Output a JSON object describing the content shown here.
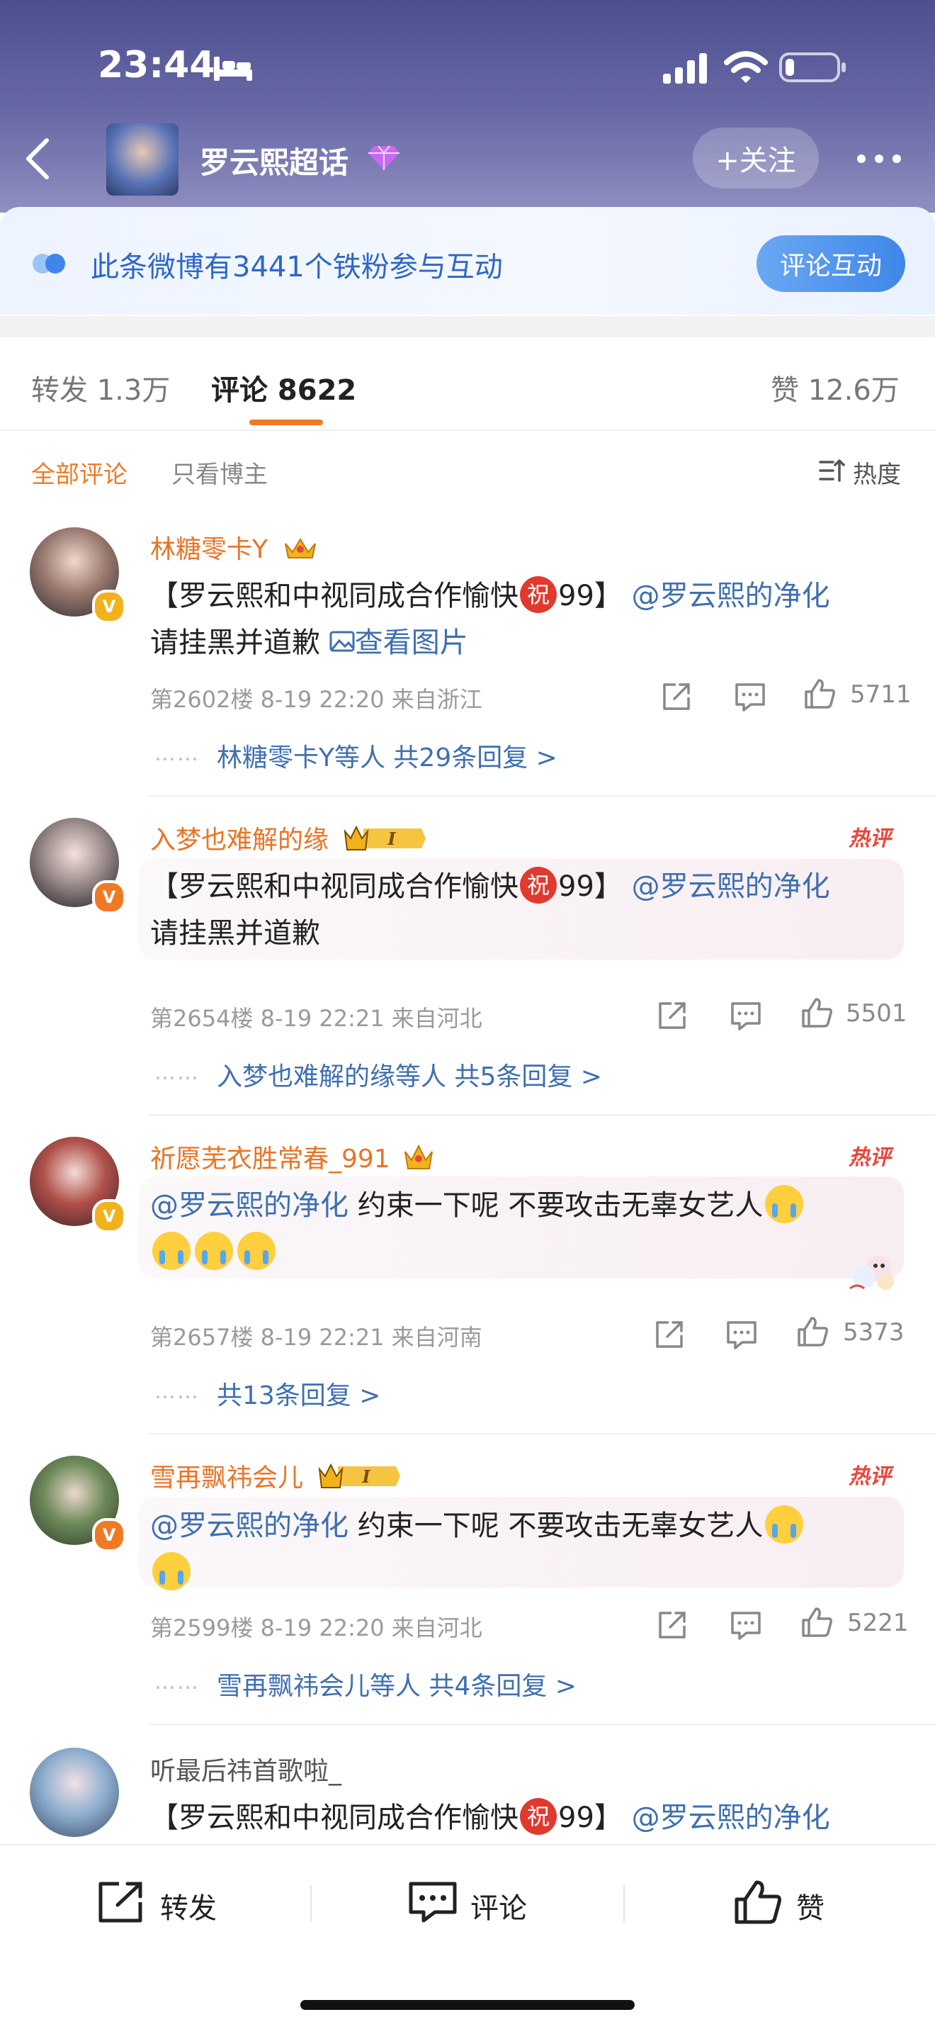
{
  "status_bar": {
    "time": "23:44",
    "icons": [
      "bed-icon",
      "signal-icon",
      "wifi-icon",
      "battery-icon"
    ]
  },
  "nav": {
    "title": "罗云熙超话",
    "follow_label": "+关注",
    "icons": [
      "back-icon",
      "diamond-icon",
      "more-icon"
    ]
  },
  "fans_banner": {
    "text": "此条微博有3441个铁粉参与互动",
    "button": "评论互动"
  },
  "tabs": {
    "forward": "转发 1.3万",
    "comments": "评论 8622",
    "likes": "赞 12.6万"
  },
  "filters": {
    "all": "全部评论",
    "owner_only": "只看博主",
    "sort": "热度"
  },
  "colors": {
    "accent": "#f07a23",
    "link": "#3f6fb0",
    "hot": "#e8463a",
    "header": "#5b5c9c"
  },
  "comments": [
    {
      "name": "林糖零卡Y",
      "badge": "V",
      "text_a": "【罗云熙和中视同成合作愉快",
      "zhu": "祝",
      "text_b": "99】",
      "mention": "@罗云熙的净化",
      "text_c": "请挂黑并道歉",
      "pic_link": "查看图片",
      "meta": "第2602楼 8-19 22:20 来自浙江",
      "likes": "5711",
      "dots": "……",
      "replies": "林糖零卡Y等人  共29条回复 >"
    },
    {
      "name": "入梦也难解的缘",
      "badge": "V",
      "hot": "热评",
      "text_a": "【罗云熙和中视同成合作愉快",
      "zhu": "祝",
      "text_b": "99】",
      "mention": "@罗云熙的净化",
      "text_c": "请挂黑并道歉",
      "meta": "第2654楼 8-19 22:21 来自河北",
      "likes": "5501",
      "dots": "……",
      "replies": "入梦也难解的缘等人  共5条回复 >"
    },
    {
      "name": "祈愿芜衣胜常春_991",
      "badge": "V",
      "hot": "热评",
      "mention": "@罗云熙的净化",
      "text_a": " 约束一下呢  不要攻击无辜女艺人",
      "meta": "第2657楼 8-19 22:21 来自河南",
      "likes": "5373",
      "dots": "……",
      "replies": "共13条回复 >"
    },
    {
      "name": "雪再飘祎会儿",
      "badge": "V",
      "hot": "热评",
      "mention": "@罗云熙的净化",
      "text_a": " 约束一下呢  不要攻击无辜女艺人",
      "meta": "第2599楼 8-19 22:20 来自河北",
      "likes": "5221",
      "dots": "……",
      "replies": "雪再飘祎会儿等人  共4条回复 >"
    },
    {
      "name": "听最后祎首歌啦_",
      "text_a": "【罗云熙和中视同成合作愉快",
      "zhu": "祝",
      "text_b": "99】",
      "mention": "@罗云熙的净化"
    }
  ],
  "bottom_bar": {
    "forward": "转发",
    "comment": "评论",
    "like": "赞"
  }
}
